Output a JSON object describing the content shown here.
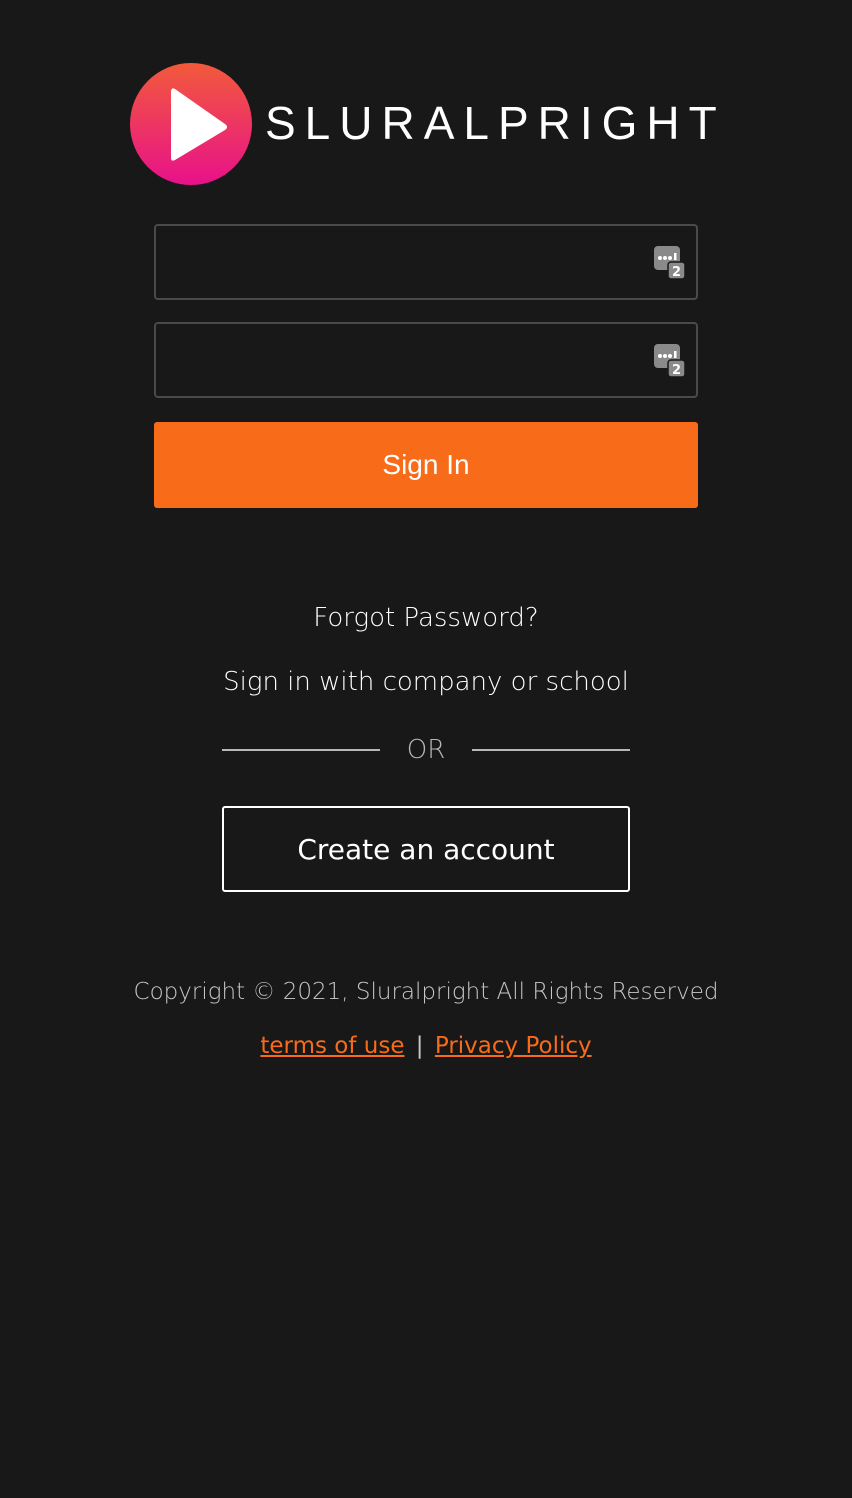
{
  "brand": {
    "name": "SLURALPRIGHT",
    "logo_icon": "play-icon",
    "gradient_top": "#f25a3a",
    "gradient_bottom": "#e8118a"
  },
  "form": {
    "username": {
      "value": "",
      "placeholder": ""
    },
    "password": {
      "value": "",
      "placeholder": ""
    },
    "field_icon": "password-manager-icon",
    "field_icon_badge": "2",
    "signin_label": "Sign In"
  },
  "links": {
    "forgot_password": "Forgot Password?",
    "company_signin": "Sign in with company or school",
    "or": "OR",
    "create_account": "Create an account"
  },
  "footer": {
    "copyright": "Copyright © 2021, Sluralpright All Rights Reserved",
    "terms": "terms of use",
    "separator": "|",
    "privacy": "Privacy Policy"
  },
  "colors": {
    "background": "#181818",
    "accent": "#f76b19",
    "text": "#ffffff",
    "muted": "#c8c8c8"
  }
}
